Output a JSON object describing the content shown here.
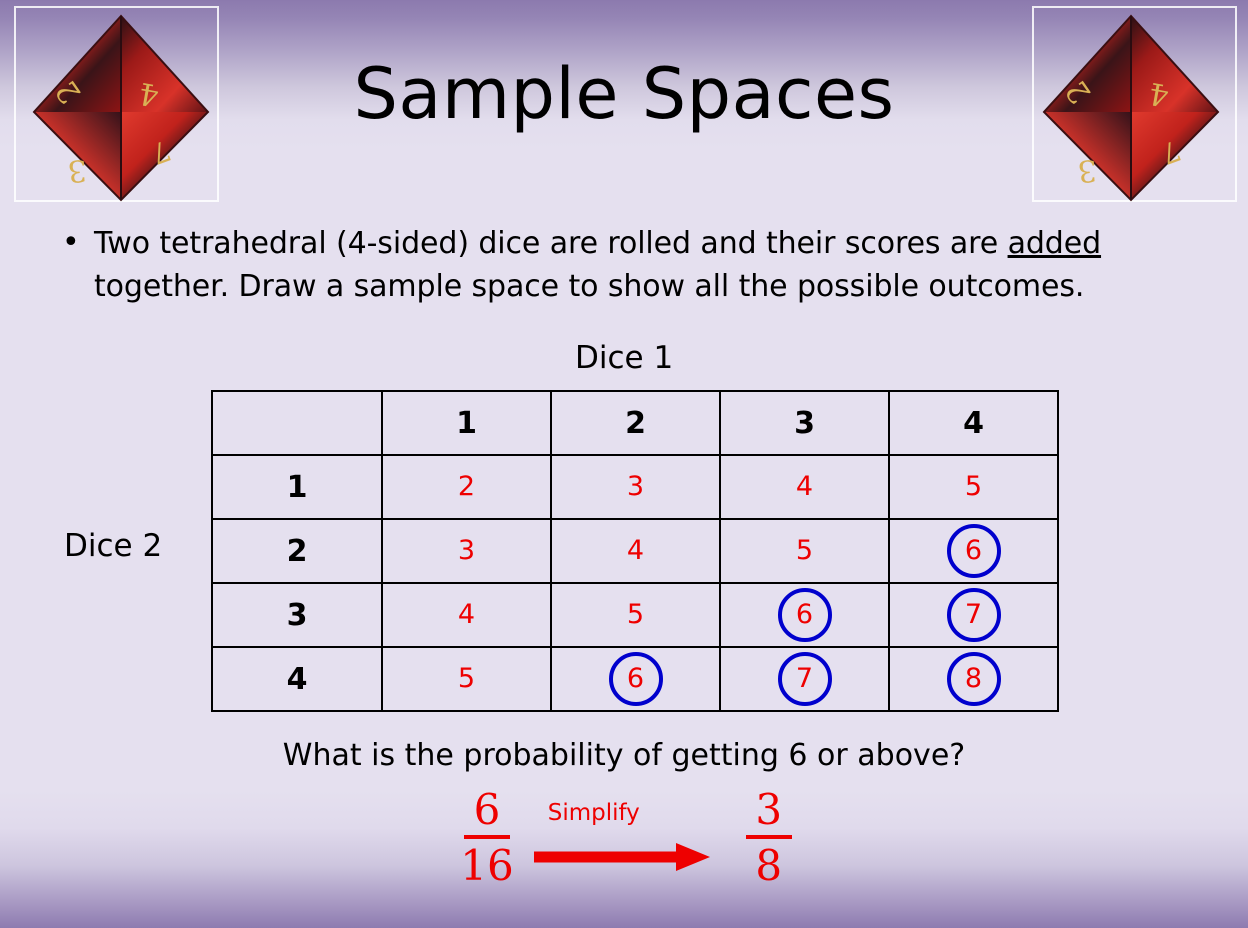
{
  "slide": {
    "title": "Sample Spaces",
    "background_top_color": "#8c7aae",
    "background_mid_color": "#e5e0ef",
    "background_bottom_color": "#8d7bb0"
  },
  "bullet": {
    "marker": "•",
    "text_part1": "Two tetrahedral (4-sided) dice are rolled and their scores are ",
    "text_underlined": "added",
    "text_part2": " together. Draw a sample space to show all the possible outcomes."
  },
  "labels": {
    "dice1": "Dice 1",
    "dice2": "Dice 2"
  },
  "decorations": {
    "left_die": "tetrahedral-die-image",
    "right_die": "tetrahedral-die-image",
    "die_face_numbers": [
      "4",
      "2",
      "3",
      "7"
    ]
  },
  "table": {
    "corner_label": "",
    "column_headers": [
      "1",
      "2",
      "3",
      "4"
    ],
    "row_headers": [
      "1",
      "2",
      "3",
      "4"
    ],
    "rows": [
      [
        {
          "value": "2",
          "circled": false
        },
        {
          "value": "3",
          "circled": false
        },
        {
          "value": "4",
          "circled": false
        },
        {
          "value": "5",
          "circled": false
        }
      ],
      [
        {
          "value": "3",
          "circled": false
        },
        {
          "value": "4",
          "circled": false
        },
        {
          "value": "5",
          "circled": false
        },
        {
          "value": "6",
          "circled": true
        }
      ],
      [
        {
          "value": "4",
          "circled": false
        },
        {
          "value": "5",
          "circled": false
        },
        {
          "value": "6",
          "circled": true
        },
        {
          "value": "7",
          "circled": true
        }
      ],
      [
        {
          "value": "5",
          "circled": false
        },
        {
          "value": "6",
          "circled": true
        },
        {
          "value": "7",
          "circled": true
        },
        {
          "value": "8",
          "circled": true
        }
      ]
    ],
    "header_color": "#000000",
    "value_color": "#ee0000",
    "circle_color": "#0000cd",
    "border_color": "#000000"
  },
  "question": "What is the probability of getting 6 or above?",
  "answer": {
    "fraction1_numerator": "6",
    "fraction1_denominator": "16",
    "arrow_label": "Simplify",
    "fraction2_numerator": "3",
    "fraction2_denominator": "8",
    "accent_color": "#ee0000"
  }
}
